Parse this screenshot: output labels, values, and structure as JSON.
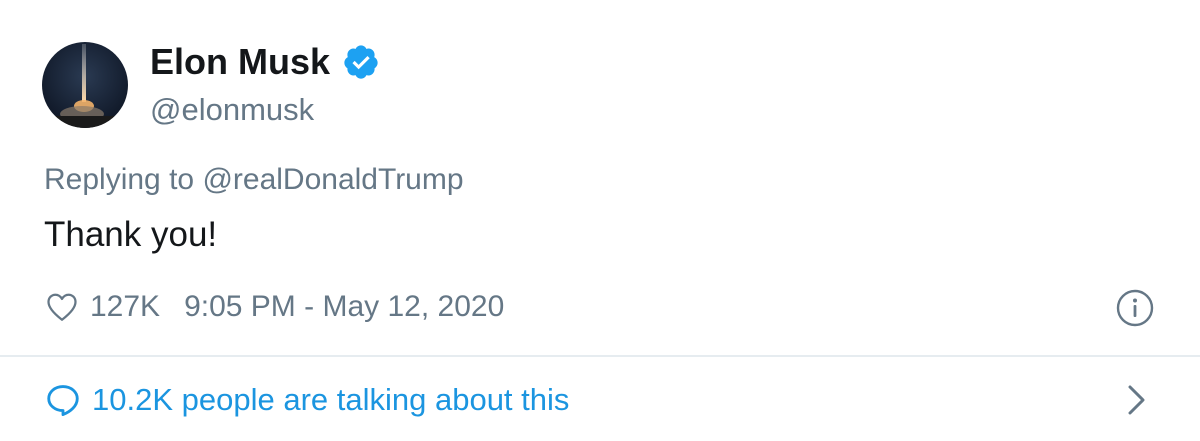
{
  "user": {
    "display_name": "Elon Musk",
    "handle": "@elonmusk",
    "verified": true,
    "avatar": "avatar-rocket-launch-night",
    "verified_color": "#1da1f2"
  },
  "reply": {
    "prefix": "Replying to",
    "mention": "@realDonaldTrump"
  },
  "tweet": {
    "text": "Thank you!"
  },
  "meta": {
    "like_icon": "heart-icon",
    "like_count": "127K",
    "timestamp": "9:05 PM - May 12, 2020",
    "info_icon": "info-icon"
  },
  "footer": {
    "talking_icon": "speech-bubble-icon",
    "talking_text": "10.2K people are talking about this",
    "chevron_icon": "chevron-right-icon",
    "link_color": "#1b95e0"
  },
  "colors": {
    "primary_text": "#14171a",
    "secondary_text": "#657786",
    "divider": "#e6ecf0"
  }
}
